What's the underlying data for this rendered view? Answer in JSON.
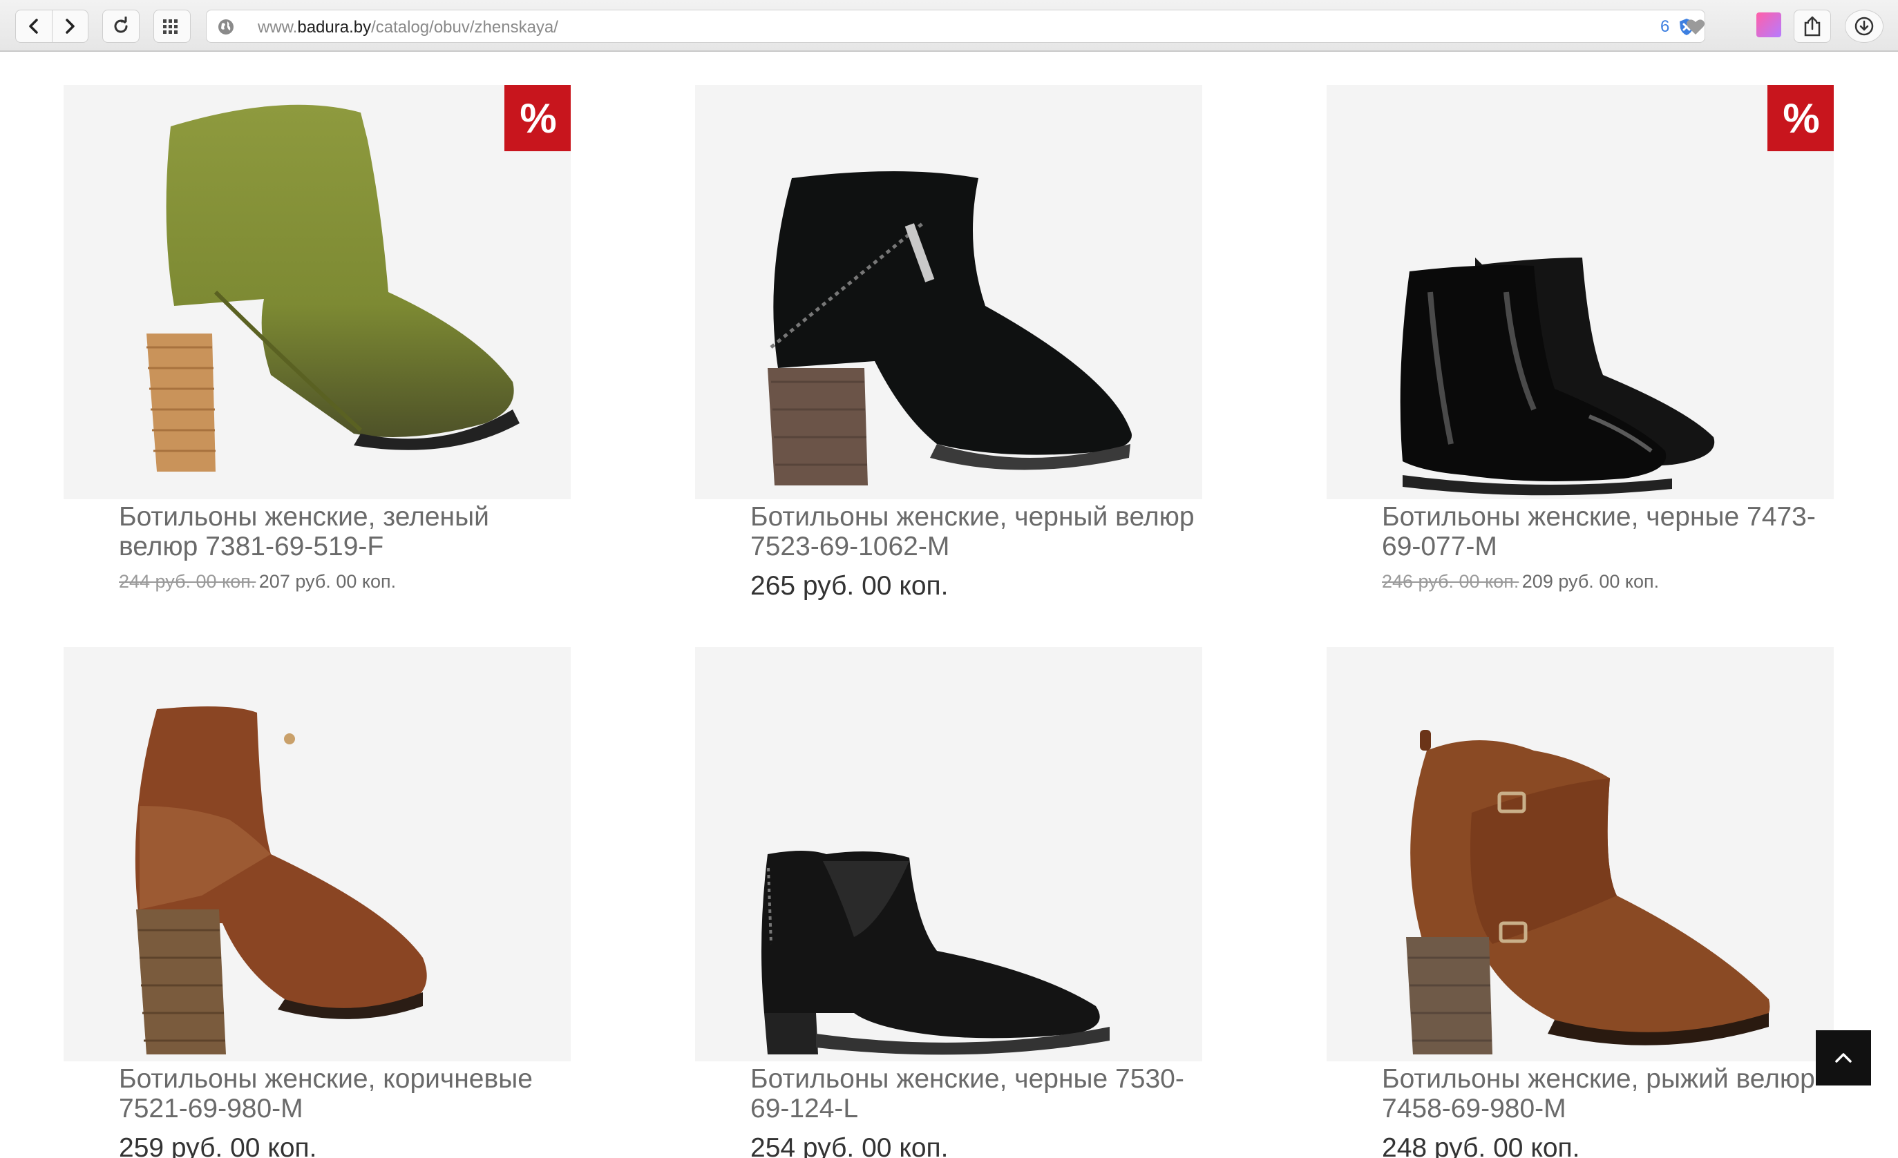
{
  "browser": {
    "url_prefix": "www.",
    "url_host": "badura.by",
    "url_path": "/catalog/obuv/zhenskaya/",
    "extension_badge": "6"
  },
  "products": [
    {
      "title": "Ботильоны женские, зеленый велюр 7381-69-519-F",
      "old_price": "244 руб. 00 коп.",
      "price": "207 руб. 00 коп.",
      "badge": "%"
    },
    {
      "title": "Ботильоны женские, черный велюр 7523-69-1062-M",
      "price": "265 руб. 00 коп."
    },
    {
      "title": "Ботильоны женские, черные 7473-69-077-M",
      "old_price": "246 руб. 00 коп.",
      "price": "209 руб. 00 коп.",
      "badge": "%"
    },
    {
      "title": "Ботильоны женские, коричневые 7521-69-980-M",
      "price": "259 руб. 00 коп."
    },
    {
      "title": "Ботильоны женские, черные 7530-69-124-L",
      "price": "254 руб. 00 коп."
    },
    {
      "title": "Ботильоны женские, рыжий велюр 7458-69-980-M",
      "price": "248 руб. 00 коп."
    }
  ],
  "colors": {
    "sale_badge": "#c8151d",
    "scroll_top_button": "#111111"
  }
}
